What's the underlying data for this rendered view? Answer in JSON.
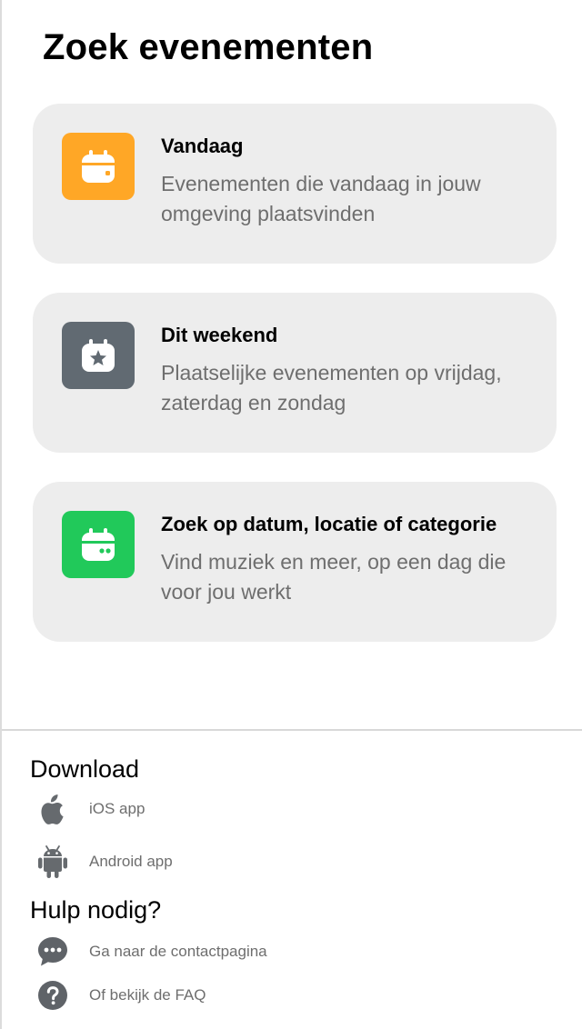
{
  "page": {
    "title": "Zoek evenementen"
  },
  "cards": [
    {
      "title": "Vandaag",
      "description": "Evenementen die vandaag in jouw omgeving plaatsvinden",
      "icon": "calendar-icon",
      "color": "#ffa726"
    },
    {
      "title": "Dit weekend",
      "description": "Plaatselijke evenementen op vrijdag, zaterdag en zondag",
      "icon": "calendar-star-icon",
      "color": "#616a72"
    },
    {
      "title": "Zoek op datum, locatie of categorie",
      "description": "Vind muziek en meer, op een dag die voor jou werkt",
      "icon": "calendar-search-icon",
      "color": "#21c95a"
    }
  ],
  "footer": {
    "download_heading": "Download",
    "download_links": [
      {
        "label": "iOS app",
        "icon": "apple-icon"
      },
      {
        "label": "Android app",
        "icon": "android-icon"
      }
    ],
    "help_heading": "Hulp nodig?",
    "help_links": [
      {
        "label": "Ga naar de contactpagina",
        "icon": "chat-bubble-icon"
      },
      {
        "label": "Of bekijk de FAQ",
        "icon": "question-icon"
      }
    ]
  },
  "colors": {
    "card_background": "#ededed",
    "muted_text": "#6e6e6e",
    "icon_gray": "#5f6368"
  }
}
